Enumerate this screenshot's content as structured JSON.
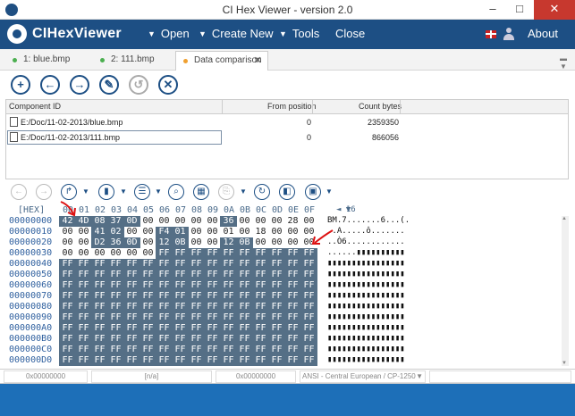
{
  "window": {
    "title": "CI Hex Viewer - version 2.0",
    "min": "–",
    "max": "□",
    "close": "✕"
  },
  "menu": {
    "brand": "CIHexViewer",
    "items": [
      "Open",
      "Create New",
      "Tools",
      "Close"
    ],
    "about": "About"
  },
  "tabs": [
    {
      "label": "1: blue.bmp",
      "dot": "#4caf50"
    },
    {
      "label": "2: 111.bmp",
      "dot": "#4caf50"
    },
    {
      "label": "Data comparison",
      "dot": "#f0a030",
      "close": "✕"
    }
  ],
  "toolbar1": {
    "icons": [
      "plus-icon",
      "arrow-left-icon",
      "arrow-right-icon",
      "pencil-icon",
      "undo-icon",
      "close-circle-icon"
    ],
    "glyphs": [
      "+",
      "←",
      "→",
      "✎",
      "↺",
      "✕"
    ]
  },
  "grid": {
    "headers": [
      "Component ID",
      "From position",
      "Count bytes"
    ],
    "rows": [
      {
        "id": "E:/Doc/11-02-2013/blue.bmp",
        "from": "0",
        "count": "2359350"
      },
      {
        "id": "E:/Doc/11-02-2013/111.bmp",
        "from": "0",
        "count": "866056"
      }
    ]
  },
  "toolbar2": {
    "glyphs": [
      "←",
      "→",
      "↱",
      "▮",
      "☰",
      "⌕",
      "▦",
      "⎘",
      "↻",
      "◧",
      "▣"
    ],
    "nav_value": "16"
  },
  "hex": {
    "offset_label": "[HEX]",
    "columns": [
      "00",
      "01",
      "02",
      "03",
      "04",
      "05",
      "06",
      "07",
      "08",
      "09",
      "0A",
      "0B",
      "0C",
      "0D",
      "0E",
      "0F"
    ],
    "rows": [
      {
        "addr": "00000000",
        "bytes": [
          "42",
          "4D",
          "08",
          "37",
          "0D",
          "00",
          "00",
          "00",
          "00",
          "00",
          "36",
          "00",
          "00",
          "00",
          "28",
          "00"
        ],
        "ascii": "BM.7.......6...(."
      },
      {
        "addr": "00000010",
        "bytes": [
          "00",
          "00",
          "41",
          "02",
          "00",
          "00",
          "F4",
          "01",
          "00",
          "00",
          "01",
          "00",
          "18",
          "00",
          "00",
          "00"
        ],
        "ascii": "..A.....ô......."
      },
      {
        "addr": "00000020",
        "bytes": [
          "00",
          "00",
          "D2",
          "36",
          "0D",
          "00",
          "12",
          "0B",
          "00",
          "00",
          "12",
          "0B",
          "00",
          "00",
          "00",
          "00"
        ],
        "ascii": "..Ò6............"
      },
      {
        "addr": "00000030",
        "bytes": [
          "00",
          "00",
          "00",
          "00",
          "00",
          "00",
          "FF",
          "FF",
          "FF",
          "FF",
          "FF",
          "FF",
          "FF",
          "FF",
          "FF",
          "FF"
        ],
        "ascii": "......▮▮▮▮▮▮▮▮▮▮"
      },
      {
        "addr": "00000040",
        "bytes": [
          "FF",
          "FF",
          "FF",
          "FF",
          "FF",
          "FF",
          "FF",
          "FF",
          "FF",
          "FF",
          "FF",
          "FF",
          "FF",
          "FF",
          "FF",
          "FF"
        ],
        "ascii": "▮▮▮▮▮▮▮▮▮▮▮▮▮▮▮▮"
      },
      {
        "addr": "00000050",
        "bytes": [
          "FF",
          "FF",
          "FF",
          "FF",
          "FF",
          "FF",
          "FF",
          "FF",
          "FF",
          "FF",
          "FF",
          "FF",
          "FF",
          "FF",
          "FF",
          "FF"
        ],
        "ascii": "▮▮▮▮▮▮▮▮▮▮▮▮▮▮▮▮"
      },
      {
        "addr": "00000060",
        "bytes": [
          "FF",
          "FF",
          "FF",
          "FF",
          "FF",
          "FF",
          "FF",
          "FF",
          "FF",
          "FF",
          "FF",
          "FF",
          "FF",
          "FF",
          "FF",
          "FF"
        ],
        "ascii": "▮▮▮▮▮▮▮▮▮▮▮▮▮▮▮▮"
      },
      {
        "addr": "00000070",
        "bytes": [
          "FF",
          "FF",
          "FF",
          "FF",
          "FF",
          "FF",
          "FF",
          "FF",
          "FF",
          "FF",
          "FF",
          "FF",
          "FF",
          "FF",
          "FF",
          "FF"
        ],
        "ascii": "▮▮▮▮▮▮▮▮▮▮▮▮▮▮▮▮"
      },
      {
        "addr": "00000080",
        "bytes": [
          "FF",
          "FF",
          "FF",
          "FF",
          "FF",
          "FF",
          "FF",
          "FF",
          "FF",
          "FF",
          "FF",
          "FF",
          "FF",
          "FF",
          "FF",
          "FF"
        ],
        "ascii": "▮▮▮▮▮▮▮▮▮▮▮▮▮▮▮▮"
      },
      {
        "addr": "00000090",
        "bytes": [
          "FF",
          "FF",
          "FF",
          "FF",
          "FF",
          "FF",
          "FF",
          "FF",
          "FF",
          "FF",
          "FF",
          "FF",
          "FF",
          "FF",
          "FF",
          "FF"
        ],
        "ascii": "▮▮▮▮▮▮▮▮▮▮▮▮▮▮▮▮"
      },
      {
        "addr": "000000A0",
        "bytes": [
          "FF",
          "FF",
          "FF",
          "FF",
          "FF",
          "FF",
          "FF",
          "FF",
          "FF",
          "FF",
          "FF",
          "FF",
          "FF",
          "FF",
          "FF",
          "FF"
        ],
        "ascii": "▮▮▮▮▮▮▮▮▮▮▮▮▮▮▮▮"
      },
      {
        "addr": "000000B0",
        "bytes": [
          "FF",
          "FF",
          "FF",
          "FF",
          "FF",
          "FF",
          "FF",
          "FF",
          "FF",
          "FF",
          "FF",
          "FF",
          "FF",
          "FF",
          "FF",
          "FF"
        ],
        "ascii": "▮▮▮▮▮▮▮▮▮▮▮▮▮▮▮▮"
      },
      {
        "addr": "000000C0",
        "bytes": [
          "FF",
          "FF",
          "FF",
          "FF",
          "FF",
          "FF",
          "FF",
          "FF",
          "FF",
          "FF",
          "FF",
          "FF",
          "FF",
          "FF",
          "FF",
          "FF"
        ],
        "ascii": "▮▮▮▮▮▮▮▮▮▮▮▮▮▮▮▮"
      },
      {
        "addr": "000000D0",
        "bytes": [
          "FF",
          "FF",
          "FF",
          "FF",
          "FF",
          "FF",
          "FF",
          "FF",
          "FF",
          "FF",
          "FF",
          "FF",
          "FF",
          "FF",
          "FF",
          "FF"
        ],
        "ascii": "▮▮▮▮▮▮▮▮▮▮▮▮▮▮▮▮"
      }
    ],
    "highlighted": [
      [
        0,
        0
      ],
      [
        0,
        1
      ],
      [
        0,
        2
      ],
      [
        0,
        3
      ],
      [
        0,
        4
      ],
      [
        0,
        10
      ],
      [
        1,
        2
      ],
      [
        1,
        3
      ],
      [
        1,
        6
      ],
      [
        1,
        7
      ],
      [
        2,
        2
      ],
      [
        2,
        3
      ],
      [
        2,
        4
      ],
      [
        2,
        6
      ],
      [
        2,
        7
      ],
      [
        2,
        10
      ],
      [
        2,
        11
      ]
    ]
  },
  "status": {
    "offset1": "0x00000000",
    "na": "[n/a]",
    "offset2": "0x00000000",
    "encoding": "ANSI - Central European / CP-1250"
  },
  "colors": {
    "accent": "#1d4f84",
    "status": "#1d6fb8",
    "arrow": "#dd1111"
  }
}
